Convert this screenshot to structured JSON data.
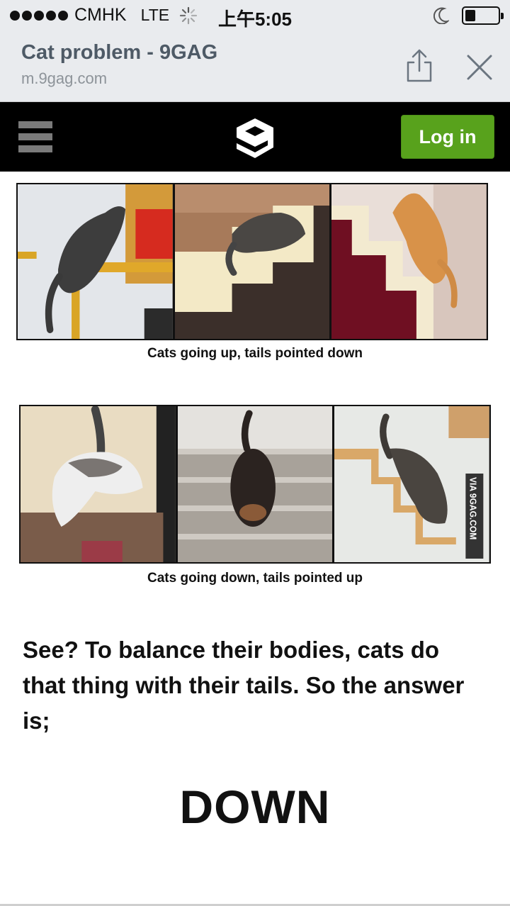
{
  "status_bar": {
    "carrier": "CMHK",
    "network": "LTE",
    "time": "上午5:05",
    "icons": [
      "signal-dots-icon",
      "loading-spinner-icon",
      "moon-icon",
      "battery-icon"
    ]
  },
  "browser": {
    "page_title": "Cat problem - 9GAG",
    "url": "m.9gag.com",
    "icons": [
      "share-icon",
      "close-icon"
    ]
  },
  "header": {
    "icons": [
      "hamburger-menu-icon",
      "9gag-logo-icon"
    ],
    "login_label": "Log in"
  },
  "post": {
    "caption_up": "Cats going up, tails pointed down",
    "caption_down": "Cats going down, tails pointed up",
    "watermark": "VIA 9GAG.COM",
    "body_text": "See? To balance their bodies, cats do that thing with their tails. So the answer is;",
    "answer": "DOWN"
  },
  "colors": {
    "chrome_bg": "#e9ebee",
    "header_bg": "#000000",
    "login_green": "#58a21c",
    "title_gray": "#4e5a66"
  }
}
